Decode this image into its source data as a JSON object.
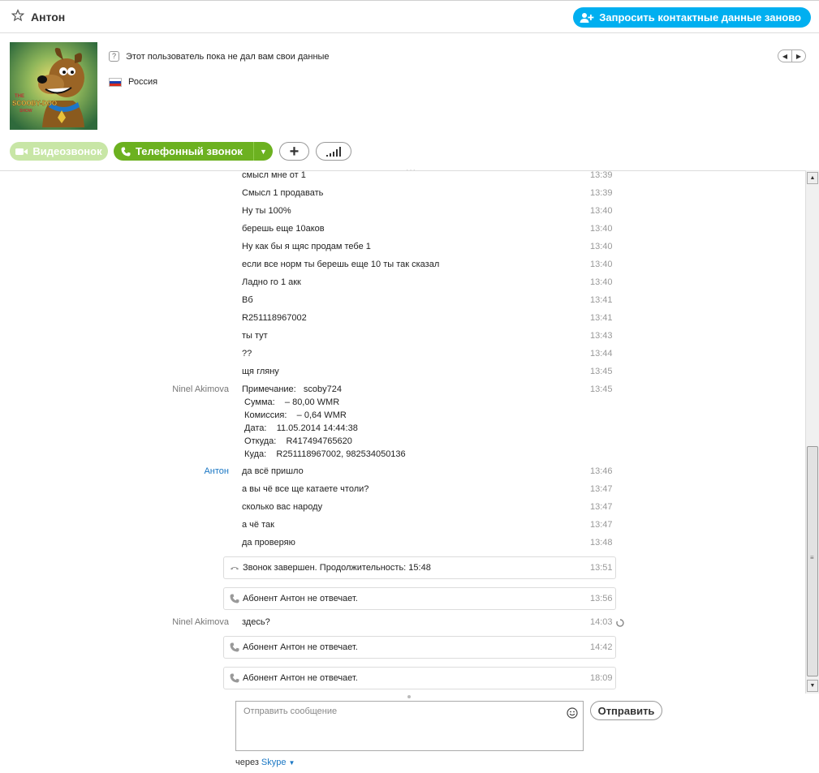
{
  "header": {
    "contact_name": "Антон",
    "request_button": "Запросить контактные данные заново"
  },
  "profile": {
    "status_text": "Этот пользователь пока не дал вам свои данные",
    "country": "Россия",
    "avatar_caption": "The Scooby-Doo Show"
  },
  "call_bar": {
    "video_call": "Видеозвонок",
    "phone_call": "Телефонный звонок",
    "add_symbol": "+"
  },
  "messages": [
    {
      "sender": "",
      "text": "смысл мне от 1",
      "time": "13:39"
    },
    {
      "sender": "",
      "text": "Смысл 1 продавать",
      "time": "13:39"
    },
    {
      "sender": "",
      "text": "Ну ты 100%",
      "time": "13:40"
    },
    {
      "sender": "",
      "text": "берешь еще 10аков",
      "time": "13:40"
    },
    {
      "sender": "",
      "text": "Ну как бы я щяс продам тебе 1",
      "time": "13:40"
    },
    {
      "sender": "",
      "text": "если все норм ты берешь еще 10 ты так сказал",
      "time": "13:40"
    },
    {
      "sender": "",
      "text": "Ладно го 1 акк",
      "time": "13:40"
    },
    {
      "sender": "",
      "text": "Вб",
      "time": "13:41"
    },
    {
      "sender": "",
      "text": "R251118967002",
      "time": "13:41"
    },
    {
      "sender": "",
      "text": "ты тут",
      "time": "13:43"
    },
    {
      "sender": "",
      "text": "??",
      "time": "13:44"
    },
    {
      "sender": "",
      "text": "щя гляну",
      "time": "13:45"
    }
  ],
  "note_message": {
    "sender": "Ninel Akimova",
    "time": "13:45",
    "lines": [
      "Примечание:   scoby724",
      " Сумма:    – 80,00 WMR",
      " Комиссия:    – 0,64 WMR",
      " Дата:    11.05.2014 14:44:38",
      " Откуда:    R417494765620",
      " Куда:    R251118967002, 982534050136"
    ]
  },
  "messages2": [
    {
      "sender": "Антон",
      "text": "да всё пришло",
      "time": "13:46"
    },
    {
      "sender": "",
      "text": "а вы чё все ще катаете чтоли?",
      "time": "13:47"
    },
    {
      "sender": "",
      "text": "сколько вас народу",
      "time": "13:47"
    },
    {
      "sender": "",
      "text": "а чё так",
      "time": "13:47"
    },
    {
      "sender": "",
      "text": "да проверяю",
      "time": "13:48"
    }
  ],
  "system_events": [
    {
      "text": "Звонок завершен. Продолжительность: 15:48",
      "time": "13:51"
    },
    {
      "text": "Абонент Антон не отвечает.",
      "time": "13:56"
    },
    {
      "text": "Абонент Антон не отвечает.",
      "time": "14:42"
    },
    {
      "text": "Абонент Антон не отвечает.",
      "time": "18:09"
    }
  ],
  "last_message": {
    "sender": "Ninel Akimova",
    "text": "здесь?",
    "time": "14:03"
  },
  "composer": {
    "placeholder": "Отправить сообщение",
    "send_button": "Отправить",
    "via_label": "через",
    "via_service": "Skype"
  },
  "colors": {
    "accent": "#00aff0",
    "call_green": "#6cb120",
    "link_blue": "#1a77c4"
  }
}
